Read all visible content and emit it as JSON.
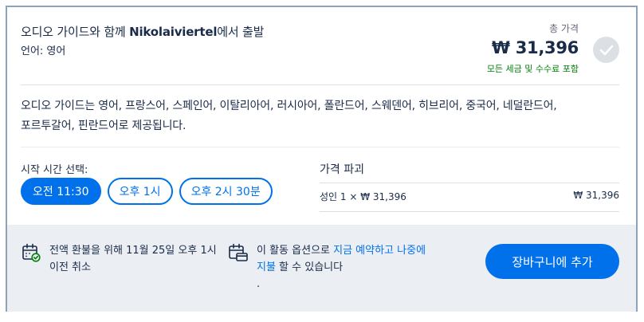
{
  "option": {
    "title_prefix": "오디오 가이드와 함께 ",
    "title_place": "Nikolaiviertel",
    "title_suffix": "에서 출발",
    "language": "언어: 영어"
  },
  "price": {
    "label": "총 가격",
    "total": "₩ 31,396",
    "note": "모든 세금 및 수수료 포함"
  },
  "description": "오디오 가이드는 영어, 프랑스어, 스페인어, 이탈리아어, 러시아어, 폴란드어, 스웨덴어, 히브리어, 중국어, 네덜란드어, 포르투갈어, 핀란드어로 제공됩니다.",
  "time_selection": {
    "label": "시작 시간 선택:",
    "options": [
      "오전 11:30",
      "오후 1시",
      "오후 2시 30분"
    ],
    "selected_index": 0
  },
  "breakdown": {
    "title": "가격 파괴",
    "rows": [
      {
        "label": "성인 1 × ₩ 31,396",
        "amount": "₩ 31,396"
      }
    ]
  },
  "footer": {
    "refund_text": "전액 환불을 위해 11월 25일 오후 1시 이전 취소",
    "reserve_before": "이 활동 옵션으로 ",
    "reserve_link": "지금 예약하고 나중에 지불",
    "reserve_after": " 할 수 있습니다",
    "reserve_tail": ".",
    "cart_button": "장바구니에 추가"
  },
  "colors": {
    "accent": "#0071eb",
    "text": "#1a2b49",
    "success": "#008009",
    "footer_bg": "#ebeef2"
  },
  "icons": {
    "select": "check-icon",
    "refund": "calendar-check-icon",
    "reserve": "calendar-card-icon"
  }
}
